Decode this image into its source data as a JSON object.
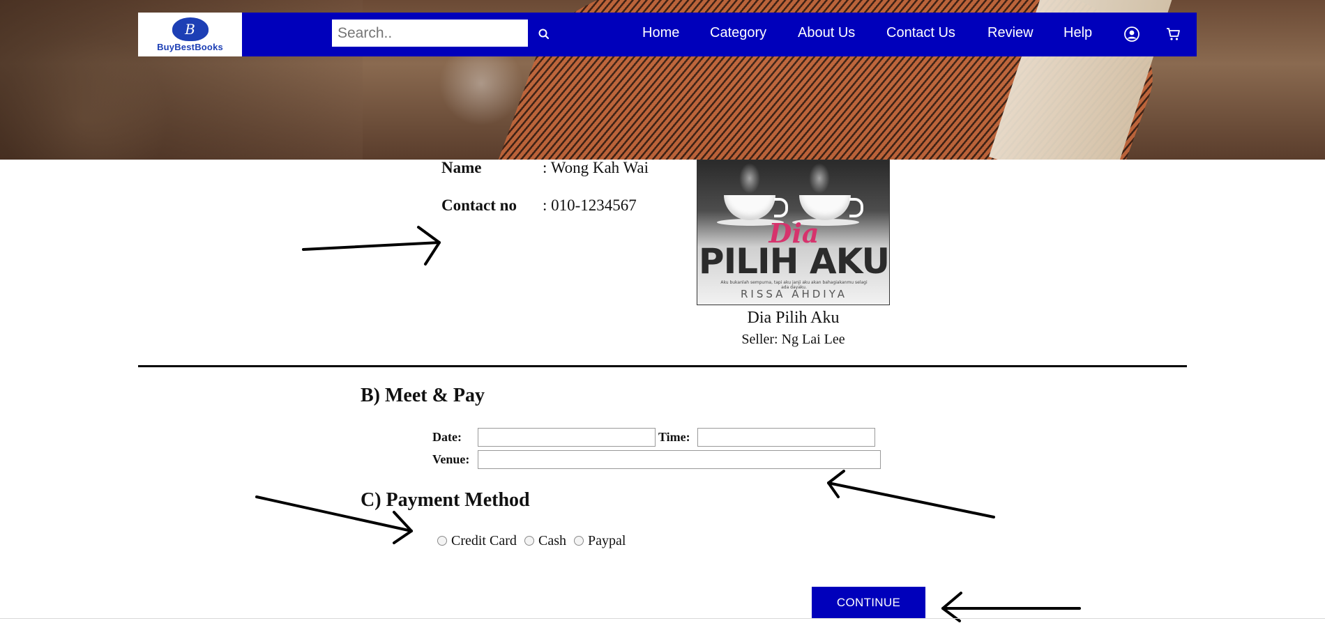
{
  "brand": {
    "logo_letter": "B",
    "name": "BuyBestBooks",
    "nav_color": "#0000bb"
  },
  "search": {
    "placeholder": "Search..",
    "icon": "search-icon"
  },
  "nav": {
    "items": [
      {
        "label": "Home"
      },
      {
        "label": "Category"
      },
      {
        "label": "About Us"
      },
      {
        "label": "Contact Us"
      },
      {
        "label": "Review"
      },
      {
        "label": "Help"
      }
    ],
    "account_icon": "user-circle-icon",
    "cart_icon": "cart-icon"
  },
  "seller_info": {
    "name_label": "Name",
    "name_value": ": Wong Kah Wai",
    "contact_label": "Contact no",
    "contact_value": ": 010-1234567"
  },
  "book": {
    "cover_script": "Dia",
    "cover_title": "PILIH AKU",
    "cover_tagline": "Aku bukanlah sempurna, tapi aku janji aku akan bahagiakanmu selagi ada dayaku.",
    "cover_author": "RISSA AHDIYA",
    "title": "Dia Pilih Aku",
    "seller": "Seller: Ng Lai Lee"
  },
  "meet_pay": {
    "heading": "B) Meet & Pay",
    "date_label": "Date:",
    "date_value": "",
    "time_label": "Time:",
    "time_value": "",
    "venue_label": "Venue:",
    "venue_value": ""
  },
  "payment": {
    "heading": "C) Payment Method",
    "options": [
      {
        "label": "Credit Card",
        "selected": false
      },
      {
        "label": "Cash",
        "selected": false
      },
      {
        "label": "Paypal",
        "selected": false
      }
    ]
  },
  "actions": {
    "continue_label": "CONTINUE"
  },
  "annotations": {
    "arrow_color": "#000000",
    "arrow_icon": "hand-drawn-arrow"
  }
}
